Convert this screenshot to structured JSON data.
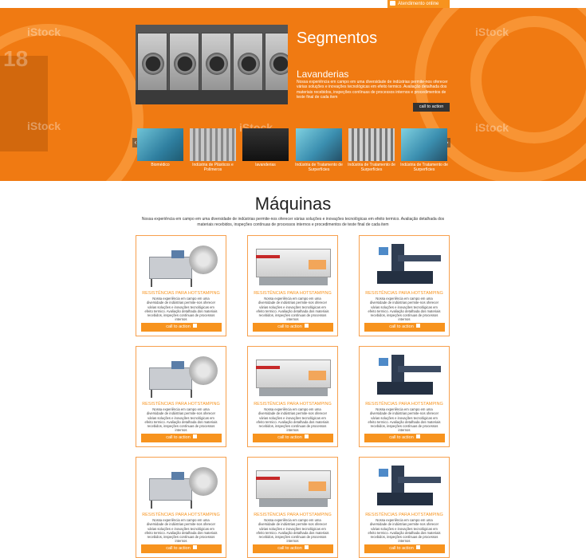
{
  "topbar": {
    "chat_label": "Atendimento online"
  },
  "hero": {
    "watermarks": [
      "iStock",
      "iStock",
      "iStock",
      "iStock",
      "iStock"
    ],
    "big_number": "18",
    "title": "Segmentos",
    "subtitle": "Lavanderias",
    "description": "Nossa experiência em campo em uma diversidade de indústrias permite-nos oferecer várias soluções e inovações tecnológicas em efeito termico. Avaliação detalhada dos materiais recebidos, inspeções contínuas de processos internos e procedimentos de teste final de cada item",
    "cta_label": "call to action",
    "thumbnails": [
      {
        "label": "Biomédico"
      },
      {
        "label": "Indústria de Plásticos e Polímeros"
      },
      {
        "label": "lavanderias"
      },
      {
        "label": "Indústria de Tratamento de Surperfícies"
      },
      {
        "label": "Indústria de Tratamento de Surperfícies"
      },
      {
        "label": "Indústria de Tratamento de Surperfícies"
      }
    ],
    "prev_arrow": "‹",
    "next_arrow": "›"
  },
  "maquinas": {
    "title": "Máquinas",
    "description": "Nossa experiência em campo em uma diversidade de indústrias permite-nos oferecer várias soluções e inovações tecnológicas em efeito termico. Avaliação detalhada dos materiais recebidos, inspeções contínuas de processos internos e procedimentos de teste final de cada item",
    "card_title": "RESISTÊNCIAS PARA HOTSTAMPING",
    "card_desc": "Nossa experiência em campo em uma diversidade de indústrias permite-nos oferecer várias soluções e inovações tecnológicas em efeito termico. Avaliação detalhada dos materiais recebidos, inspeções contínuas de processos internos",
    "card_cta": "call to action"
  },
  "colors": {
    "accent": "#f7931e",
    "hero_bg": "#f07a12",
    "dark_button": "#333333"
  },
  "icons": {
    "chat": "chat-bubble-icon",
    "cta": "arrow-right-icon"
  }
}
